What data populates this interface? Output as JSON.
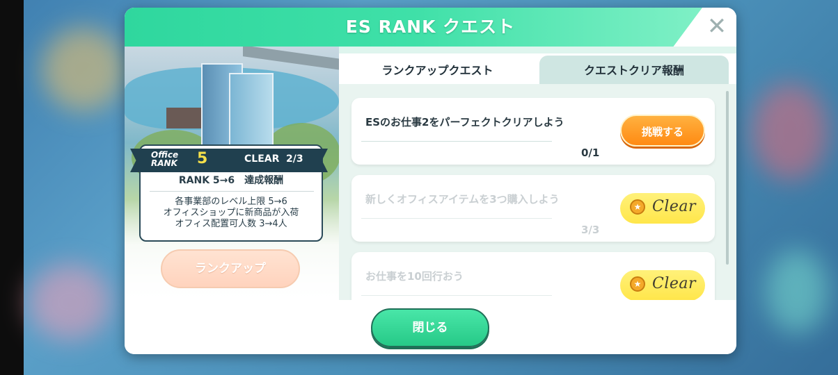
{
  "dialog": {
    "title": "ES RANK クエスト",
    "close_icon": "✕"
  },
  "rank": {
    "office_label_line1": "Office",
    "office_label_line2": "RANK",
    "level": "5",
    "clear_label": "CLEAR",
    "clear_count": "2/3",
    "reward_title": "RANK 5→6　達成報酬",
    "benefits": [
      "各事業部のレベル上限 5→6",
      "オフィスショップに新商品が入荷",
      "オフィス配置可人数 3→4人"
    ],
    "rankup_button": "ランクアップ"
  },
  "tabs": [
    {
      "label": "ランクアップクエスト",
      "active": true
    },
    {
      "label": "クエストクリア報酬",
      "active": false
    }
  ],
  "quests": [
    {
      "title": "ESのお仕事2をパーフェクトクリアしよう",
      "progress": "0/1",
      "status": "challenge",
      "button": "挑戦する"
    },
    {
      "title": "新しくオフィスアイテムを3つ購入しよう",
      "progress": "3/3",
      "status": "clear",
      "button": "Clear"
    },
    {
      "title": "お仕事を10回行おう",
      "progress": "",
      "status": "clear",
      "button": "Clear"
    }
  ],
  "footer": {
    "close_button": "閉じる"
  },
  "colors": {
    "header_green": "#3fe0a8",
    "challenge_orange": "#ff8a12",
    "clear_yellow": "#ffe64a",
    "ribbon_navy": "#20404f"
  }
}
